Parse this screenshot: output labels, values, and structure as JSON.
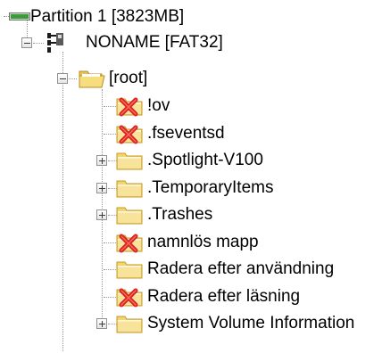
{
  "tree": {
    "partition": {
      "label": "Partition 1 [3823MB]",
      "icon": "partition-icon"
    },
    "volume": {
      "label": "NONAME [FAT32]",
      "icon": "volume-icon",
      "expanded": true
    },
    "root": {
      "label": "[root]",
      "icon": "folder-open-icon",
      "expanded": true
    },
    "items": [
      {
        "label": "!ov",
        "icon": "deleted-folder-icon",
        "expandable": false
      },
      {
        "label": ".fseventsd",
        "icon": "deleted-folder-icon",
        "expandable": false
      },
      {
        "label": ".Spotlight-V100",
        "icon": "folder-icon",
        "expandable": true
      },
      {
        "label": ".TemporaryItems",
        "icon": "folder-icon",
        "expandable": true
      },
      {
        "label": ".Trashes",
        "icon": "folder-icon",
        "expandable": true
      },
      {
        "label": "namnlös mapp",
        "icon": "deleted-folder-icon",
        "expandable": false
      },
      {
        "label": "Radera efter användning",
        "icon": "folder-icon",
        "expandable": false
      },
      {
        "label": "Radera efter läsning",
        "icon": "deleted-folder-icon",
        "expandable": false
      },
      {
        "label": "System Volume Information",
        "icon": "folder-icon",
        "expandable": true
      }
    ]
  },
  "colors": {
    "folder": "#f3d66b",
    "folder_edge": "#c59a2b",
    "delete_mark": "#d8221f",
    "tree_lines": "#9a9a9a"
  }
}
